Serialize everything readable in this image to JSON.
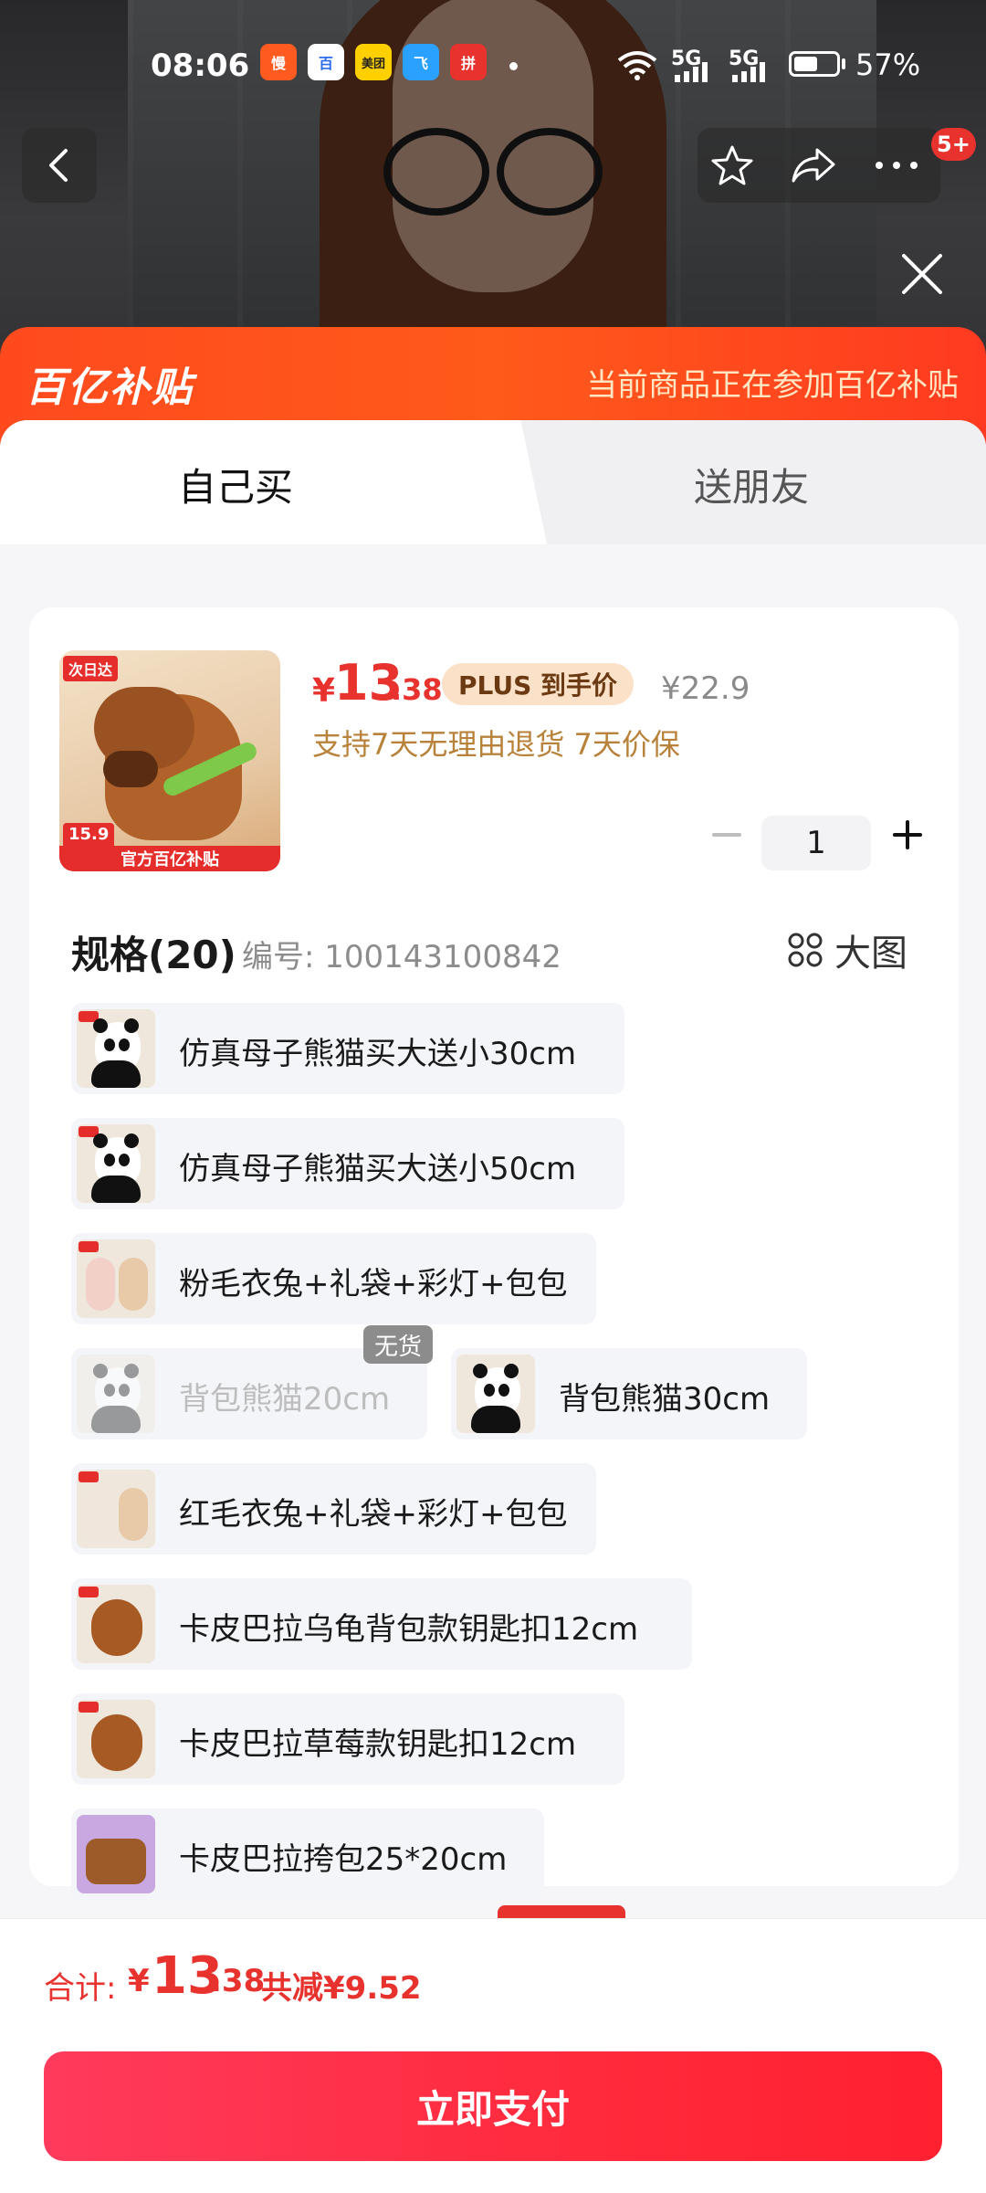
{
  "status_bar": {
    "time": "08:06",
    "apps": [
      {
        "name": "慢",
        "color": "#ff5a1f"
      },
      {
        "name": "百",
        "color": "#2b6cf0"
      },
      {
        "name": "美团",
        "color": "#ffd000"
      },
      {
        "name": "飞",
        "color": "#2aa0ff"
      },
      {
        "name": "拼",
        "color": "#e8322e"
      }
    ],
    "signal_1": "5G",
    "signal_2": "5G",
    "battery_level": 0.57,
    "battery_pct": "57%"
  },
  "header": {
    "badge": "5+"
  },
  "subsidy_banner": {
    "logo": "百亿补贴",
    "text": "当前商品正在参加百亿补贴"
  },
  "tabs": {
    "self": "自己买",
    "gift": "送朋友"
  },
  "product": {
    "image": {
      "tag_top": "次日达",
      "price_tag": "15.9",
      "bottom_label": "官方百亿补贴"
    },
    "price_currency": "¥",
    "price_int": "13",
    "price_dec": ".38",
    "plus_tag": "PLUS 到手价",
    "original_price": "¥22.9",
    "guarantee": "支持7天无理由退货  7天价保",
    "quantity": "1"
  },
  "spec": {
    "title": "规格(20)",
    "code": "编号: 100143100842",
    "big_image": "大图",
    "options": [
      {
        "label": "仿真母子熊猫买大送小30cm",
        "thumb": "panda"
      },
      {
        "label": "仿真母子熊猫买大送小50cm",
        "thumb": "panda"
      },
      {
        "label": "粉毛衣兔+礼袋+彩灯+包包",
        "thumb": "rabbit-pink"
      },
      {
        "label": "背包熊猫20cm",
        "thumb": "panda",
        "disabled": true
      },
      {
        "label": "背包熊猫30cm",
        "thumb": "panda"
      },
      {
        "label": "红毛衣兔+礼袋+彩灯+包包",
        "thumb": "rabbit-red"
      },
      {
        "label": "卡皮巴拉乌龟背包款钥匙扣12cm",
        "thumb": "capy"
      },
      {
        "label": "卡皮巴拉草莓款钥匙扣12cm",
        "thumb": "capy"
      },
      {
        "label": "卡皮巴拉挎包25*20cm",
        "thumb": "bag"
      }
    ],
    "nostock": "无货"
  },
  "footer": {
    "total_label": "合计:",
    "total_currency": "¥",
    "total_int": "13",
    "total_dec": ".38",
    "saving": "共减¥9.52",
    "pay_button": "立即支付"
  },
  "colors": {
    "accent": "#e8322e",
    "subsidy_orange": "#ff4a1e",
    "gold_text": "#b8823a"
  }
}
